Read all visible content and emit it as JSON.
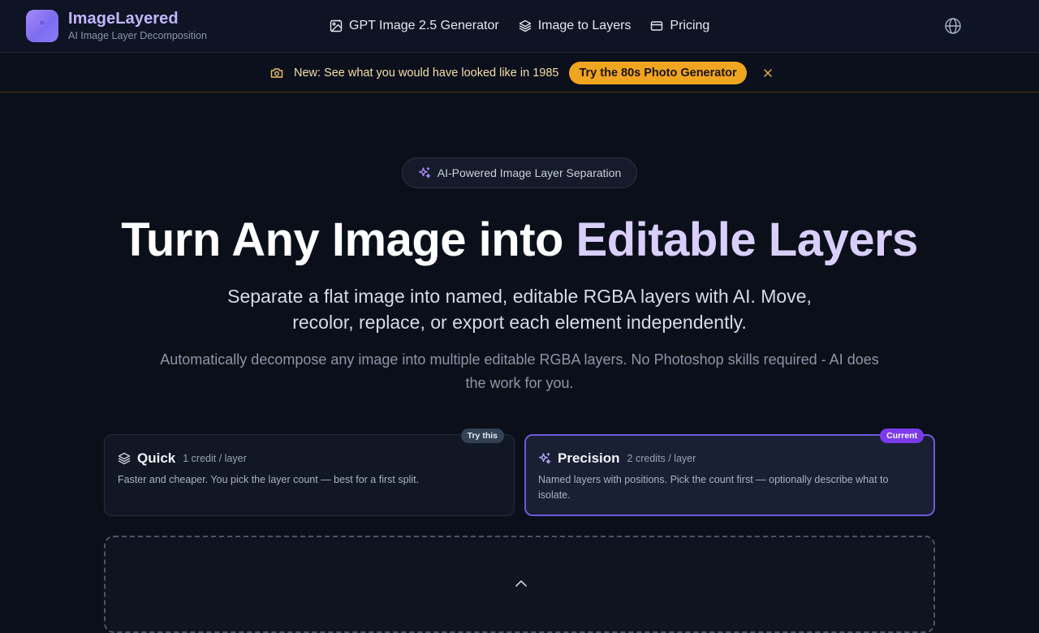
{
  "header": {
    "brand_name": "ImageLayered",
    "brand_tagline": "AI Image Layer Decomposition",
    "nav": [
      {
        "label": "GPT Image 2.5 Generator",
        "icon": "image-icon"
      },
      {
        "label": "Image to Layers",
        "icon": "layers-icon"
      },
      {
        "label": "Pricing",
        "icon": "credit-card-icon"
      }
    ],
    "language_icon": "globe-icon"
  },
  "banner": {
    "icon": "camera-icon",
    "text": "New: See what you would have looked like in 1985",
    "cta": "Try the 80s Photo Generator",
    "close_icon": "close-icon"
  },
  "hero": {
    "pill": "AI-Powered Image Layer Separation",
    "title_part1": "Turn Any Image into ",
    "title_part2": "Editable Layers",
    "subtitle": "Separate a flat image into named, editable RGBA layers with AI. Move, recolor, replace, or export each element independently.",
    "description": "Automatically decompose any image into multiple editable RGBA layers. No Photoshop skills required - AI does the work for you."
  },
  "modes": [
    {
      "name": "Quick",
      "price": "1 credit / layer",
      "description": "Faster and cheaper. You pick the layer count — best for a first split.",
      "badge": "Try this",
      "selected": false
    },
    {
      "name": "Precision",
      "price": "2 credits / layer",
      "description": "Named layers with positions. Pick the count first — optionally describe what to isolate.",
      "badge": "Current",
      "selected": true
    }
  ],
  "colors": {
    "background": "#0b0f1a",
    "accent": "#7c3aed",
    "brand": "#c4b5fd",
    "banner_cta": "#f0a520"
  }
}
